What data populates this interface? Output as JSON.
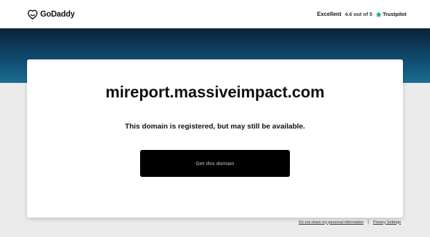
{
  "header": {
    "logo_text": "GoDaddy",
    "logo_icon": "godaddy-logo-icon",
    "rating_label": "Excellent",
    "rating_score": "4.6 out of 5",
    "trustpilot_icon": "trustpilot-star-icon",
    "trustpilot_name": "Trustpilot"
  },
  "main": {
    "domain": "mireport.massiveimpact.com",
    "status": "This domain is registered, but may still be available.",
    "cta_label": "Get this domain"
  },
  "footer": {
    "do_not_share": "Do not share my personal information",
    "separator": "|",
    "privacy": "Privacy Settings"
  },
  "colors": {
    "band_top": "#09223a",
    "band_bottom": "#1a6e92",
    "cta_background": "#000000",
    "trustpilot_green": "#00b67a",
    "page_background": "#ebebeb"
  }
}
